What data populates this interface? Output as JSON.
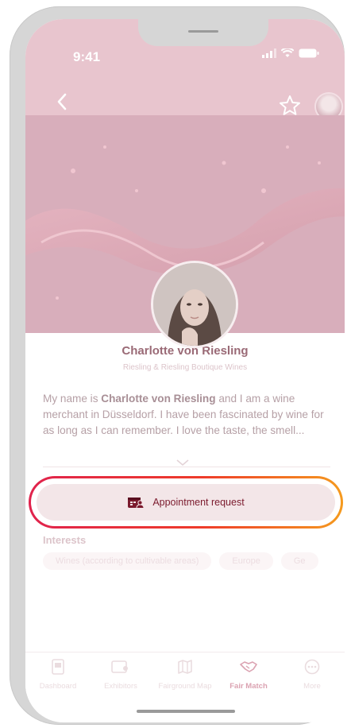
{
  "status_bar": {
    "time": "9:41"
  },
  "nav": {
    "back_icon": "chevron-left-icon",
    "favorite_icon": "star-icon",
    "avatar_icon": "user-avatar"
  },
  "profile": {
    "name": "Charlotte von Riesling",
    "company": "Riesling & Riesling Boutique Wines",
    "bio_prefix": "My name is ",
    "bio_name": "Charlotte von Riesling",
    "bio_rest": " and I am a wine merchant in Düsseldorf. I have been fascinated by wine for as long as I can remember. I love the taste, the smell..."
  },
  "actions": {
    "appointment_label": "Appointment request"
  },
  "interests": {
    "title": "Interests",
    "chips": [
      "Wines (according to cultivable areas)",
      "Europe",
      "Ge"
    ]
  },
  "tabbar": {
    "items": [
      {
        "label": "Dashboard",
        "icon": "tablet-icon",
        "active": false
      },
      {
        "label": "Exhibitors",
        "icon": "exhibitor-card-icon",
        "active": false
      },
      {
        "label": "Fairground Map",
        "icon": "map-icon",
        "active": false
      },
      {
        "label": "Fair Match",
        "icon": "handshake-icon",
        "active": true
      },
      {
        "label": "More",
        "icon": "more-dots-icon",
        "active": false
      }
    ]
  },
  "colors": {
    "accent": "#7b1a2d",
    "header_tint": "#e8c5ce",
    "hero_tint": "#d8aebb",
    "highlight_ring_start": "#e0234d",
    "highlight_ring_end": "#f59a1e"
  }
}
